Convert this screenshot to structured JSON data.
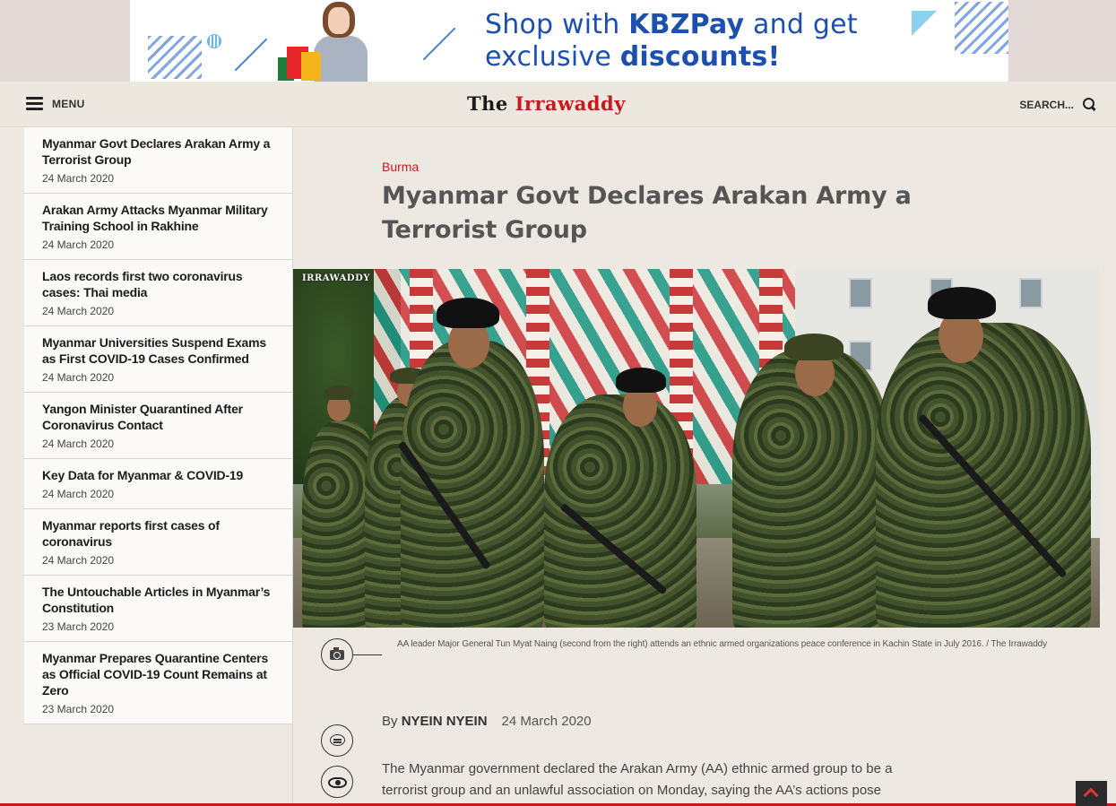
{
  "ad": {
    "line1_pre": "Shop with ",
    "line1_brand": "KBZPay",
    "line1_post": " and get",
    "line2_pre": "exclusive ",
    "line2_bold": "discounts!"
  },
  "header": {
    "menu_label": "MENU",
    "logo_the": "The ",
    "logo_name": "Irrawaddy",
    "search_placeholder": "SEARCH..."
  },
  "sidebar": {
    "items": [
      {
        "title": "Myanmar Govt Declares Arakan Army a Terrorist Group",
        "date": "24 March 2020"
      },
      {
        "title": "Arakan Army Attacks Myanmar Military Training School in Rakhine",
        "date": "24 March 2020"
      },
      {
        "title": "Laos records first two coronavirus cases: Thai media",
        "date": "24 March 2020"
      },
      {
        "title": "Myanmar Universities Suspend Exams as First COVID-19 Cases Confirmed",
        "date": "24 March 2020"
      },
      {
        "title": "Yangon Minister Quarantined After Coronavirus Contact",
        "date": "24 March 2020"
      },
      {
        "title": "Key Data for Myanmar & COVID-19",
        "date": "24 March 2020"
      },
      {
        "title": "Myanmar reports first cases of coronavirus",
        "date": "24 March 2020"
      },
      {
        "title": "The Untouchable Articles in Myanmar’s Constitution",
        "date": "23 March 2020"
      },
      {
        "title": "Myanmar Prepares Quarantine Centers as Official COVID-19 Count Remains at Zero",
        "date": "23 March 2020"
      }
    ]
  },
  "article": {
    "category": "Burma",
    "headline": "Myanmar Govt Declares Arakan Army a Terrorist Group",
    "photo_watermark": "IRRAWADDY",
    "caption": "AA leader Major General Tun Myat Naing (second from the right) attends an ethnic armed organizations peace conference in Kachin State in July 2016. / The Irrawaddy",
    "by_prefix": "By ",
    "author": "NYEIN NYEIN",
    "date": "24 March 2020",
    "body": "The Myanmar government declared the Arakan Army (AA) ethnic armed group to be a terrorist group and an unlawful association on Monday, saying the AA’s actions pose"
  },
  "colors": {
    "accent_red": "#c8191f",
    "ad_blue": "#1d4fb1",
    "background": "#ede9e2"
  }
}
